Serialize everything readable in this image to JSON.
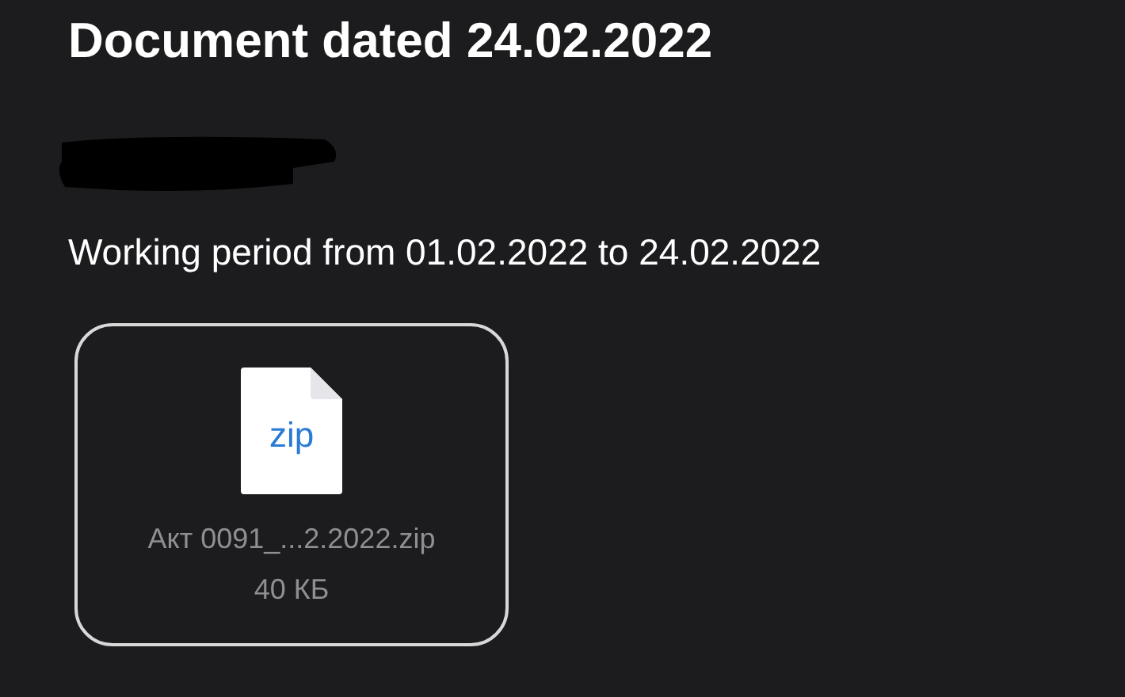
{
  "title": "Document dated 24.02.2022",
  "period": "Working period from 01.02.2022 to 24.02.2022",
  "attachment": {
    "file_type": "zip",
    "file_name": "Акт 0091_...2.2022.zip",
    "size": "40 КБ"
  }
}
